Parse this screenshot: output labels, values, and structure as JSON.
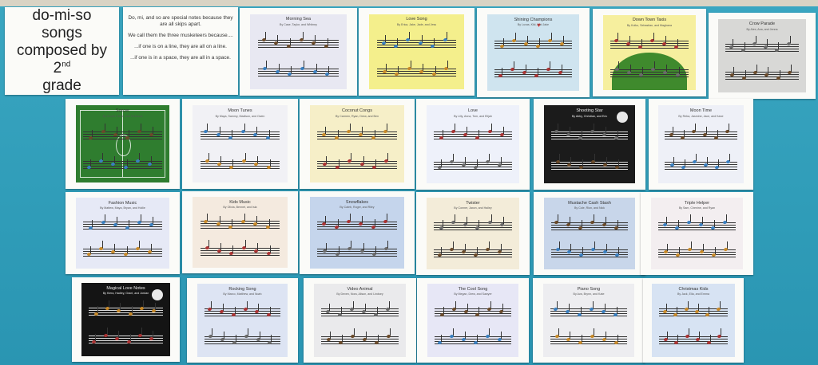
{
  "title": {
    "line1": "do-mi-so",
    "line2": "songs",
    "line3": "composed by",
    "line4_num": "2",
    "line4_sup": "nd",
    "line5": "grade"
  },
  "notes": {
    "p1": "Do, mi, and so are special notes because they are all skips apart.",
    "p2": "We call them the three musketeers because....",
    "p3": "...if one is on a line, they are all on a line.",
    "p4": "...if one is in a space, they are all in a space."
  },
  "songs": [
    {
      "title": "Morning Sea",
      "authors": "By Case, Taylor, and Whitney",
      "bg": "#e8e8f2"
    },
    {
      "title": "Love Song",
      "authors": "By Erica, Jake, Jade, and Jess",
      "bg": "#f4ef8c"
    },
    {
      "title": "Shining Champions",
      "authors": "By Luvas, Kiki, and Jake",
      "bg": "#cfe4ef"
    },
    {
      "title": "Down Town Taxis",
      "authors": "By Koiko, Sebastian, and Maghana",
      "bg": "#f6ef9e"
    },
    {
      "title": "Crow Parade",
      "authors": "By Alex, Ana, and Jenna",
      "bg": "#d8d8d6"
    },
    {
      "title": "Soccer",
      "authors": "By Grobet, Sean, and Rebecca",
      "bg": "#2f7d2f"
    },
    {
      "title": "Moon Tunes",
      "authors": "By Maya, Sammy, Madison, and Owen",
      "bg": "#f1f1f5"
    },
    {
      "title": "Coconut Congs",
      "authors": "By Carmen, Ryan, Drew, and Ben",
      "bg": "#f6efc8"
    },
    {
      "title": "Love",
      "authors": "By Lilly, Anna, Tom, and Elijah",
      "bg": "#eef1fa"
    },
    {
      "title": "Shooting Star",
      "authors": "By Abby, Christian, and Eric",
      "bg": "#1b1b1b"
    },
    {
      "title": "Moon Time",
      "authors": "By Reba, Jasmine, Jace, and Kane",
      "bg": "#eef0f7"
    },
    {
      "title": "Fashion Music",
      "authors": "By Mattew, Maya, Bryan, and Hollie",
      "bg": "#e6e9f6"
    },
    {
      "title": "Kids Music",
      "authors": "By Olivia, Bennet, and Isla",
      "bg": "#f4eadf"
    },
    {
      "title": "Snowflakes",
      "authors": "By Caleb, Roger, and Riley",
      "bg": "#c5d5ec"
    },
    {
      "title": "Twister",
      "authors": "By Conner, Jaxon, and Hailey",
      "bg": "#f3ecd9"
    },
    {
      "title": "Mustache Cash Stash",
      "authors": "By Cole, Rion, and Nick",
      "bg": "#c8d6ea"
    },
    {
      "title": "Triple Helper",
      "authors": "By Sam, Chenine, and Ryan",
      "bg": "#f3eef0"
    },
    {
      "title": "Magical Love Notes",
      "authors": "By Kiera, Hadley, Grant, and Jordan",
      "bg": "#141414"
    },
    {
      "title": "Rocking Song",
      "authors": "By Marco, Matthew, and Noah",
      "bg": "#dde4f3"
    },
    {
      "title": "Video Animal",
      "authors": "By Deven, Nora, Alison, and Lindsey",
      "bg": "#eaeaec"
    },
    {
      "title": "The Cool Song",
      "authors": "By Megan, Drew, and Sawyer",
      "bg": "#e7e7f6"
    },
    {
      "title": "Piano Song",
      "authors": "By Ava, Brynn, and Kate",
      "bg": "#ededf0"
    },
    {
      "title": "Christmas Kids",
      "authors": "By Jack, Ella, and Emma",
      "bg": "#d7e3f3"
    }
  ]
}
